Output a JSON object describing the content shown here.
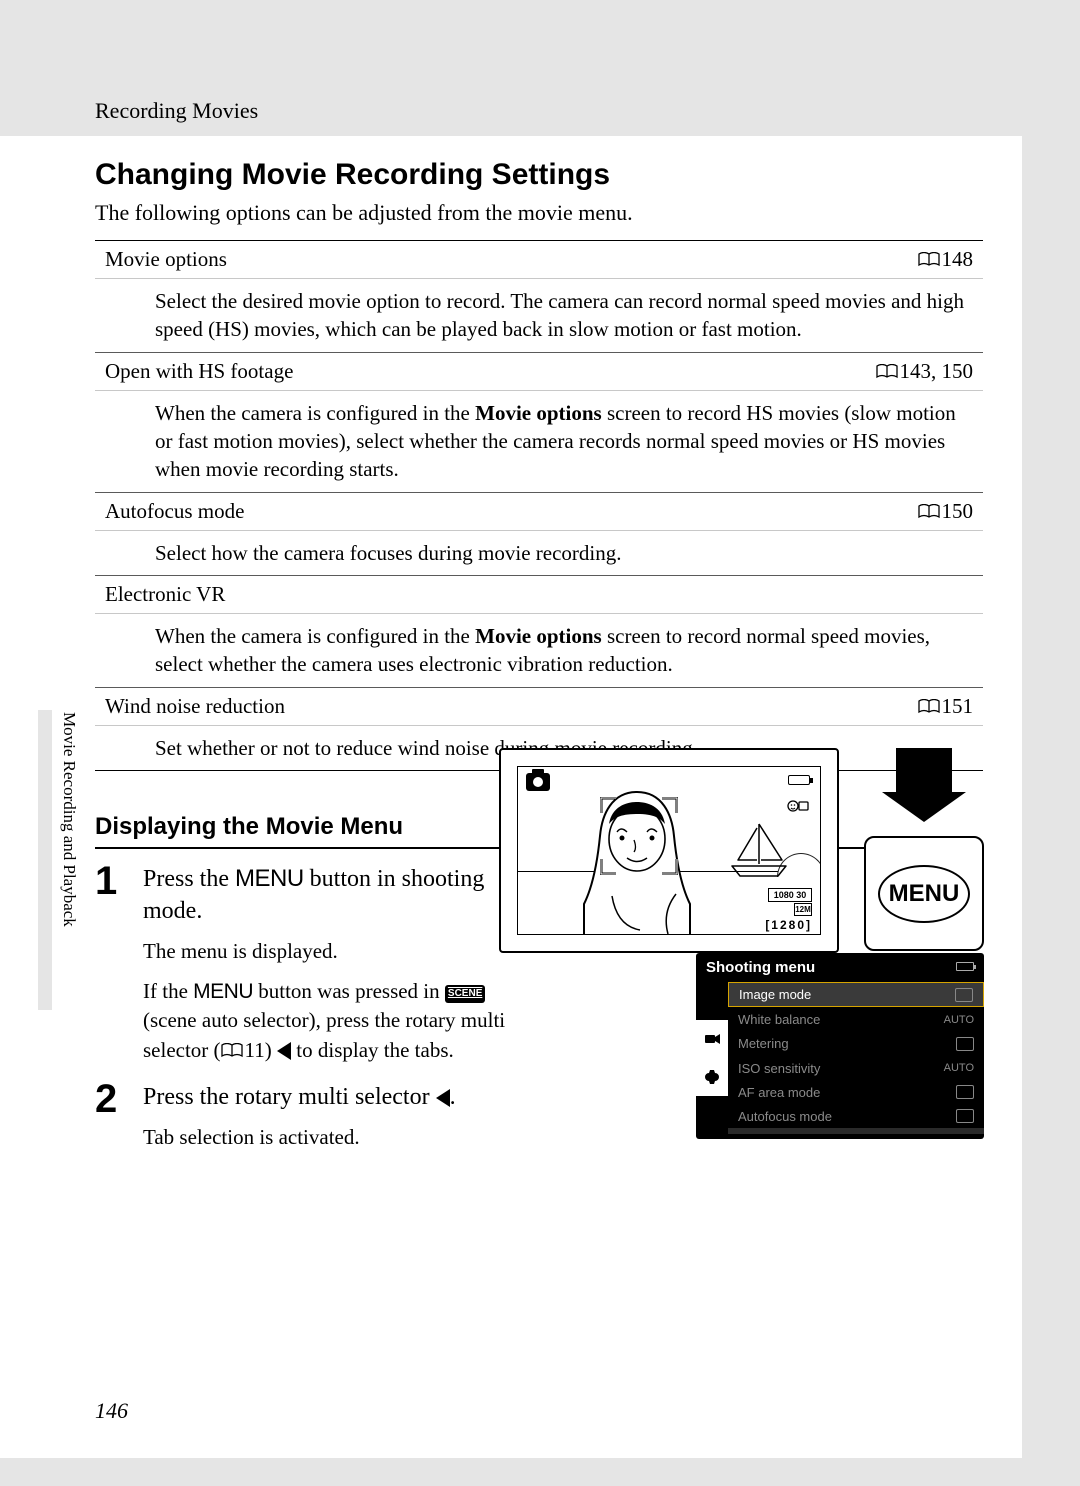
{
  "header": {
    "crumb": "Recording Movies"
  },
  "title": "Changing Movie Recording Settings",
  "intro": "The following options can be adjusted from the movie menu.",
  "options": [
    {
      "name": "Movie options",
      "page": "148",
      "desc": "Select the desired movie option to record. The camera can record normal speed movies and high speed (HS) movies, which can be played back in slow motion or fast motion."
    },
    {
      "name": "Open with HS footage",
      "page": "143, 150",
      "desc_pre": "When the camera is configured in the ",
      "desc_bold": "Movie options",
      "desc_post": " screen to record HS movies (slow motion or fast motion movies), select whether the camera records normal speed movies or HS movies when movie recording starts."
    },
    {
      "name": "Autofocus mode",
      "page": "150",
      "desc": "Select how the camera focuses during movie recording."
    },
    {
      "name": "Electronic VR",
      "page": "",
      "desc_pre": "When the camera is configured in the ",
      "desc_bold": "Movie options",
      "desc_post": " screen to record normal speed movies, select whether the camera uses electronic vibration reduction."
    },
    {
      "name": "Wind noise reduction",
      "page": "151",
      "desc": "Set whether or not to reduce wind noise during movie recording."
    }
  ],
  "subsection": "Displaying the Movie Menu",
  "steps": {
    "s1": {
      "title_pre": "Press the ",
      "menu_label": "MENU",
      "title_post": " button in shooting mode.",
      "line1": "The menu is displayed.",
      "line2_pre": "If the ",
      "line2_mid": " button was pressed in ",
      "scene_chip": "SCENE",
      "line2_post1": " (scene auto selector), press the rotary multi selector (",
      "xref": "11",
      "line2_post2": ") ",
      "line2_post3": " to display the tabs."
    },
    "s2": {
      "title": "Press the rotary multi selector ",
      "body": "Tab selection is activated."
    }
  },
  "lcd": {
    "hd": "1080 30",
    "res": "12M",
    "counter": "[1280]"
  },
  "menu_button": {
    "label": "MENU"
  },
  "shooting_menu": {
    "title": "Shooting menu",
    "rows": [
      {
        "label": "Image mode",
        "val_kind": "icon"
      },
      {
        "label": "White balance",
        "val": "AUTO"
      },
      {
        "label": "Metering",
        "val_kind": "icon"
      },
      {
        "label": "ISO sensitivity",
        "val": "AUTO"
      },
      {
        "label": "AF area mode",
        "val_kind": "icon"
      },
      {
        "label": "Autofocus mode",
        "val_kind": "icon"
      }
    ]
  },
  "side_text": "Movie Recording and Playback",
  "page_number": "146"
}
